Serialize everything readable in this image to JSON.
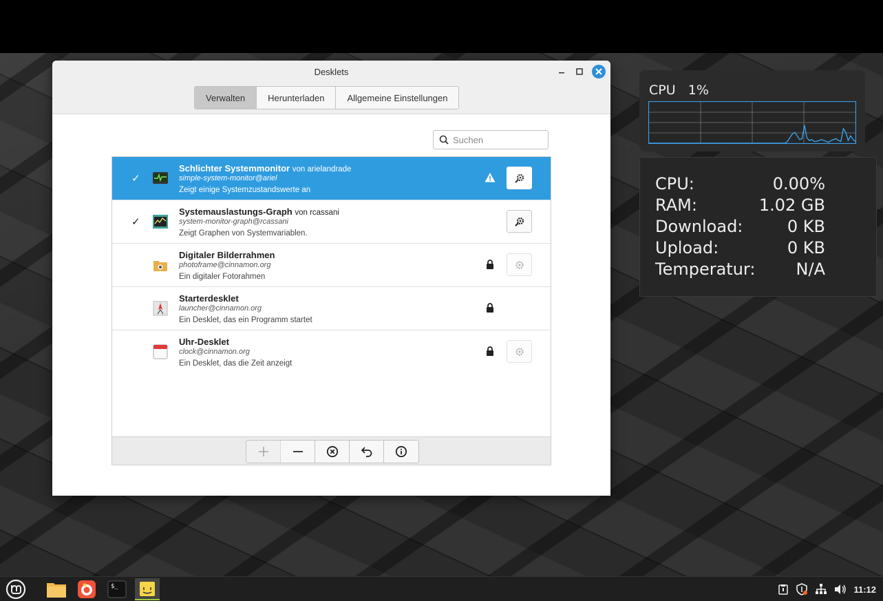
{
  "window": {
    "title": "Desklets",
    "tabs": [
      {
        "label": "Verwalten",
        "active": true
      },
      {
        "label": "Herunterladen",
        "active": false
      },
      {
        "label": "Allgemeine Einstellungen",
        "active": false
      }
    ],
    "search_placeholder": "Suchen"
  },
  "desklets": [
    {
      "name": "Schlichter Systemmonitor",
      "by": "von arielandrade",
      "uuid": "simple-system-monitor@ariel",
      "description": "Zeigt einige Systemzustandswerte an",
      "enabled": true,
      "selected": true,
      "status": "warning-icon",
      "config": "enabled"
    },
    {
      "name": "Systemauslastungs-Graph",
      "by": "von rcassani",
      "uuid": "system-monitor-graph@rcassani",
      "description": "Zeigt Graphen von Systemvariablen.",
      "enabled": true,
      "selected": false,
      "status": "",
      "config": "enabled"
    },
    {
      "name": "Digitaler Bilderrahmen",
      "by": "",
      "uuid": "photoframe@cinnamon.org",
      "description": "Ein digitaler Fotorahmen",
      "enabled": false,
      "selected": false,
      "status": "lock-icon",
      "config": "disabled"
    },
    {
      "name": "Starterdesklet",
      "by": "",
      "uuid": "launcher@cinnamon.org",
      "description": "Ein Desklet, das ein Programm startet",
      "enabled": false,
      "selected": false,
      "status": "lock-icon",
      "config": "none"
    },
    {
      "name": "Uhr-Desklet",
      "by": "",
      "uuid": "clock@cinnamon.org",
      "description": "Ein Desklet, das die Zeit anzeigt",
      "enabled": false,
      "selected": false,
      "status": "lock-icon",
      "config": "disabled"
    }
  ],
  "toolbar": [
    "plus-icon",
    "minus-icon",
    "remove-icon",
    "undo-icon",
    "info-icon"
  ],
  "cpu_graph": {
    "label": "CPU",
    "value": "1%",
    "samples": [
      0,
      0,
      0,
      0,
      0,
      0,
      0,
      0,
      0,
      0,
      0,
      0,
      0,
      0,
      0,
      0,
      0,
      0,
      0,
      0,
      0,
      0,
      0,
      0,
      0,
      0,
      0,
      0,
      0,
      0,
      0,
      0,
      0,
      0,
      0,
      0,
      0,
      0,
      0,
      0,
      0,
      0,
      0,
      0,
      0,
      0,
      0,
      0,
      0,
      0,
      0,
      0,
      0,
      0,
      0,
      0,
      0,
      2,
      6,
      10,
      12,
      8,
      4,
      5,
      20,
      6,
      3,
      4,
      2,
      2,
      3,
      4,
      3,
      2,
      1,
      3,
      4,
      5,
      3,
      2,
      16,
      12,
      3,
      8,
      4,
      2
    ]
  },
  "system_monitor": [
    {
      "label": "CPU:",
      "value": "0.00%"
    },
    {
      "label": "RAM:",
      "value": "1.02 GB"
    },
    {
      "label": "Download:",
      "value": "0 KB"
    },
    {
      "label": "Upload:",
      "value": "0 KB"
    },
    {
      "label": "Temperatur:",
      "value": "N/A"
    }
  ],
  "taskbar": {
    "clock": "11:12"
  }
}
